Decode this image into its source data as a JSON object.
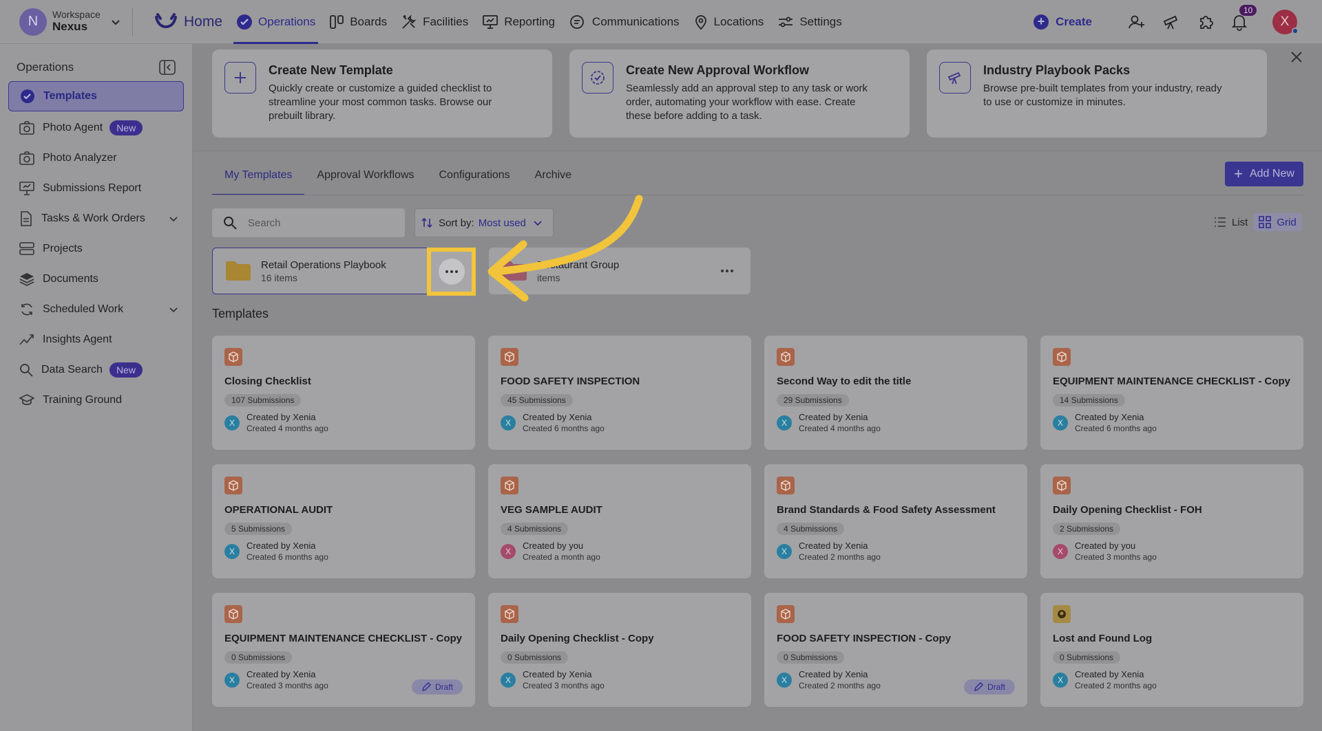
{
  "topnav": {
    "workspace_label": "Workspace",
    "workspace_name": "Nexus",
    "avatar_letter": "N",
    "home": "Home",
    "items": [
      "Operations",
      "Boards",
      "Facilities",
      "Reporting",
      "Communications",
      "Locations",
      "Settings"
    ],
    "create": "Create",
    "notification_count": "10",
    "user_letter": "X"
  },
  "sidebar": {
    "title": "Operations",
    "items": [
      {
        "label": "Templates",
        "icon": "check-circle-icon",
        "active": true
      },
      {
        "label": "Photo Agent",
        "icon": "camera-icon",
        "badge": "New"
      },
      {
        "label": "Photo Analyzer",
        "icon": "camera-icon"
      },
      {
        "label": "Submissions Report",
        "icon": "presentation-icon"
      },
      {
        "label": "Tasks & Work Orders",
        "icon": "document-icon",
        "expandable": true
      },
      {
        "label": "Projects",
        "icon": "server-icon"
      },
      {
        "label": "Documents",
        "icon": "layers-icon"
      },
      {
        "label": "Scheduled Work",
        "icon": "refresh-icon",
        "expandable": true
      },
      {
        "label": "Insights Agent",
        "icon": "trend-icon"
      },
      {
        "label": "Data Search",
        "icon": "search-icon",
        "badge": "New"
      },
      {
        "label": "Training Ground",
        "icon": "graduation-cap-icon"
      }
    ]
  },
  "banner": {
    "cards": [
      {
        "title": "Create New Template",
        "desc": "Quickly create or customize a guided checklist to streamline your most common tasks. Browse our prebuilt library."
      },
      {
        "title": "Create New Approval Workflow",
        "desc": "Seamlessly add an approval step to any task or work order, automating your workflow with ease. Create these before adding to a task."
      },
      {
        "title": "Industry Playbook Packs",
        "desc": "Browse pre-built templates from your industry, ready to use or customize in minutes."
      }
    ]
  },
  "tabs": [
    "My Templates",
    "Approval Workflows",
    "Configurations",
    "Archive"
  ],
  "add_new": "Add New",
  "search_placeholder": "Search",
  "sort": {
    "label": "Sort by:",
    "value": "Most used"
  },
  "view": {
    "list": "List",
    "grid": "Grid"
  },
  "folders": [
    {
      "name": "Retail Operations Playbook",
      "count": "16 items"
    },
    {
      "name": "Restaurant Group",
      "count": "items"
    }
  ],
  "section_title": "Templates",
  "templates": [
    {
      "title": "Closing Checklist",
      "subs": "107 Submissions",
      "by": "Created by Xenia",
      "ago": "Created 4 months ago",
      "letter": "X"
    },
    {
      "title": "FOOD SAFETY INSPECTION",
      "subs": "45 Submissions",
      "by": "Created by Xenia",
      "ago": "Created 6 months ago",
      "letter": "X"
    },
    {
      "title": "Second Way to edit the title",
      "subs": "29 Submissions",
      "by": "Created by Xenia",
      "ago": "Created 4 months ago",
      "letter": "X"
    },
    {
      "title": "EQUIPMENT MAINTENANCE CHECKLIST - Copy",
      "subs": "14 Submissions",
      "by": "Created by Xenia",
      "ago": "Created 6 months ago",
      "letter": "X"
    },
    {
      "title": "OPERATIONAL AUDIT",
      "subs": "5 Submissions",
      "by": "Created by Xenia",
      "ago": "Created 6 months ago",
      "letter": "X"
    },
    {
      "title": "VEG SAMPLE AUDIT",
      "subs": "4 Submissions",
      "by": "Created by you",
      "ago": "Created a month ago",
      "letter": "X"
    },
    {
      "title": "Brand Standards & Food Safety Assessment",
      "subs": "4 Submissions",
      "by": "Created by Xenia",
      "ago": "Created 2 months ago",
      "letter": "X"
    },
    {
      "title": "Daily Opening Checklist - FOH",
      "subs": "2 Submissions",
      "by": "Created by you",
      "ago": "Created 3 months ago",
      "letter": "X"
    },
    {
      "title": "EQUIPMENT MAINTENANCE CHECKLIST - Copy",
      "subs": "0 Submissions",
      "by": "Created by Xenia",
      "ago": "Created 3 months ago",
      "letter": "X",
      "draft": "Draft"
    },
    {
      "title": "Daily Opening Checklist - Copy",
      "subs": "0 Submissions",
      "by": "Created by Xenia",
      "ago": "Created 3 months ago",
      "letter": "X"
    },
    {
      "title": "FOOD SAFETY INSPECTION - Copy",
      "subs": "0 Submissions",
      "by": "Created by Xenia",
      "ago": "Created 2 months ago",
      "letter": "X",
      "draft": "Draft"
    },
    {
      "title": "Lost and Found Log",
      "subs": "0 Submissions",
      "by": "Created by Xenia",
      "ago": "Created 2 months ago",
      "letter": "X"
    }
  ],
  "colors": {
    "accent": "#2e2a8c",
    "highlight": "#f1c43c"
  }
}
